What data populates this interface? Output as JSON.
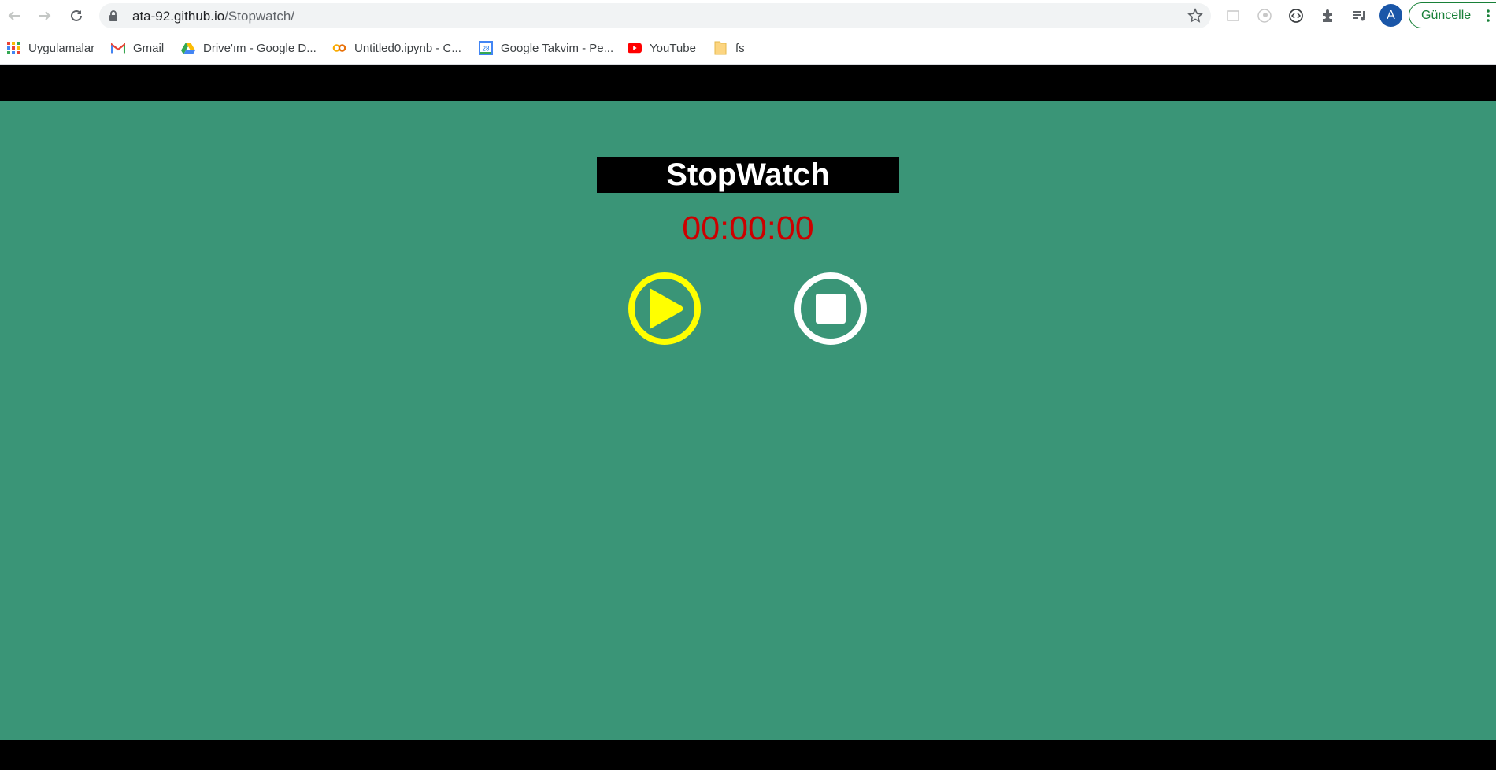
{
  "browser": {
    "url_host": "ata-92.github.io",
    "url_path": "/Stopwatch/",
    "profile_initial": "A",
    "update_label": "Güncelle"
  },
  "bookmarks": [
    {
      "label": "Uygulamalar",
      "icon": "apps-grid-icon"
    },
    {
      "label": "Gmail",
      "icon": "gmail-icon"
    },
    {
      "label": "Drive'ım - Google D...",
      "icon": "google-drive-icon"
    },
    {
      "label": "Untitled0.ipynb - C...",
      "icon": "colab-icon"
    },
    {
      "label": "Google Takvim - Pe...",
      "icon": "google-calendar-icon"
    },
    {
      "label": "YouTube",
      "icon": "youtube-icon"
    },
    {
      "label": "fs",
      "icon": "folder-icon"
    }
  ],
  "calendar_day": "28",
  "stopwatch": {
    "title": "StopWatch",
    "time": "00:00:00"
  },
  "colors": {
    "background": "#3a9577",
    "title_bg": "#000000",
    "timer_text": "#cc0000",
    "play_button": "#ffff00",
    "stop_button": "#ffffff"
  }
}
